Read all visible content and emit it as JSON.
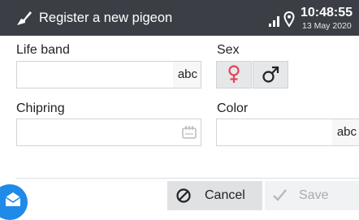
{
  "header": {
    "title": "Register a new pigeon",
    "time": "10:48:55",
    "date": "13 May 2020",
    "title_icon": "pigeon-icon",
    "signal_icon": "signal-bars-icon",
    "location_icon": "location-pin-icon"
  },
  "form": {
    "life_band": {
      "label": "Life band",
      "value": "",
      "suffix": "abc"
    },
    "sex": {
      "label": "Sex",
      "options": [
        "female",
        "male"
      ],
      "selected": ""
    },
    "chipring": {
      "label": "Chipring",
      "value": "",
      "suffix_icon": "nfc-scan-icon"
    },
    "color": {
      "label": "Color",
      "value": "",
      "suffix": "abc"
    }
  },
  "footer": {
    "cancel_label": "Cancel",
    "save_label": "Save",
    "fab_icon": "mail-icon"
  },
  "colors": {
    "header_bg": "#3b3f45",
    "accent": "#1f8ae8",
    "female": "#e0455a",
    "male": "#222222",
    "disabled_text": "#a7abb0"
  }
}
